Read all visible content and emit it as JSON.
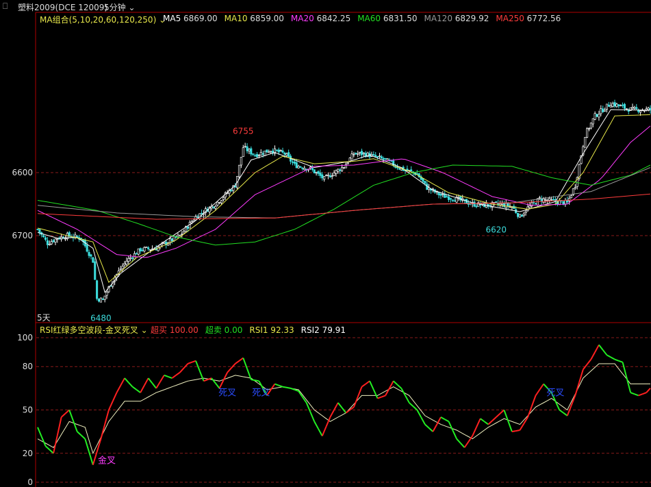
{
  "header": {
    "link_icon": "link-icon",
    "symbol": "塑料2009(DCE 12009)",
    "period": "5分钟",
    "period_caret": "chevron-down-icon"
  },
  "main_panel": {
    "ma_group_label": "MA组合(5,10,20,60,120,250)",
    "ma_legend": [
      {
        "label": "MA5",
        "value": "6869.00",
        "color": "#ffffff"
      },
      {
        "label": "MA10",
        "value": "6859.00",
        "color": "#e8e84a"
      },
      {
        "label": "MA20",
        "value": "6842.25",
        "color": "#ff3cff"
      },
      {
        "label": "MA60",
        "value": "6831.50",
        "color": "#22e022"
      },
      {
        "label": "MA120",
        "value": "6829.92",
        "color": "#9a9a9a"
      },
      {
        "label": "MA250",
        "value": "6772.56",
        "color": "#ff3c3c"
      }
    ],
    "y_ticks": [
      "6700",
      "6600"
    ],
    "period_marker": "5天",
    "annotations": [
      {
        "text": "6755",
        "color": "#ff3c3c"
      },
      {
        "text": "6620",
        "color": "#3cdcdc"
      },
      {
        "text": "6480",
        "color": "#3cdcdc"
      }
    ]
  },
  "sub_panel": {
    "indicator_label": "RSI红绿多空波段-金叉死叉",
    "legend": [
      {
        "label": "超买",
        "value": "100.00",
        "color": "#ff3c3c"
      },
      {
        "label": "超卖",
        "value": "0.00",
        "color": "#22e022"
      },
      {
        "label": "RSI1",
        "value": "92.33",
        "color": "#e8e84a"
      },
      {
        "label": "RSI2",
        "value": "79.91",
        "color": "#ffffff"
      }
    ],
    "y_ticks": [
      "100",
      "80",
      "50",
      "20",
      "0"
    ],
    "signals": [
      {
        "text": "金叉",
        "color": "#ff3cff"
      },
      {
        "text": "死叉",
        "color": "#2a4cff"
      },
      {
        "text": "死叉",
        "color": "#2a4cff"
      },
      {
        "text": "死叉",
        "color": "#2a4cff"
      }
    ]
  },
  "colors": {
    "up": "#ff3c3c",
    "down": "#3cdcdc",
    "grid": "#8a1a1a",
    "axis": "#b00000"
  },
  "chart_data": [
    {
      "type": "candlestick",
      "title": "塑料2009(DCE 12009) 5分钟",
      "ylim": [
        6480,
        6760
      ],
      "yticks": [
        6600,
        6700
      ],
      "high_label": 6755,
      "low_labels": [
        6480,
        6620
      ],
      "close_path": [
        [
          0,
          6610
        ],
        [
          5,
          6588
        ],
        [
          10,
          6596
        ],
        [
          15,
          6600
        ],
        [
          22,
          6596
        ],
        [
          28,
          6560
        ],
        [
          30,
          6500
        ],
        [
          33,
          6498
        ],
        [
          38,
          6530
        ],
        [
          45,
          6560
        ],
        [
          52,
          6578
        ],
        [
          60,
          6580
        ],
        [
          66,
          6590
        ],
        [
          72,
          6600
        ],
        [
          80,
          6630
        ],
        [
          90,
          6650
        ],
        [
          100,
          6680
        ],
        [
          104,
          6740
        ],
        [
          110,
          6728
        ],
        [
          118,
          6736
        ],
        [
          125,
          6730
        ],
        [
          130,
          6712
        ],
        [
          138,
          6706
        ],
        [
          145,
          6690
        ],
        [
          150,
          6700
        ],
        [
          155,
          6710
        ],
        [
          160,
          6730
        ],
        [
          165,
          6730
        ],
        [
          170,
          6726
        ],
        [
          176,
          6720
        ],
        [
          184,
          6706
        ],
        [
          192,
          6698
        ],
        [
          197,
          6676
        ],
        [
          204,
          6664
        ],
        [
          212,
          6658
        ],
        [
          220,
          6650
        ],
        [
          228,
          6648
        ],
        [
          234,
          6650
        ],
        [
          240,
          6646
        ],
        [
          244,
          6630
        ],
        [
          248,
          6644
        ],
        [
          254,
          6658
        ],
        [
          262,
          6654
        ],
        [
          268,
          6652
        ],
        [
          272,
          6680
        ],
        [
          277,
          6760
        ],
        [
          282,
          6790
        ],
        [
          290,
          6810
        ],
        [
          300,
          6800
        ],
        [
          310,
          6800
        ]
      ],
      "series": [
        {
          "name": "MA5",
          "path": [
            [
              0,
              6605
            ],
            [
              10,
              6596
            ],
            [
              20,
              6597
            ],
            [
              28,
              6580
            ],
            [
              34,
              6510
            ],
            [
              42,
              6540
            ],
            [
              60,
              6582
            ],
            [
              80,
              6624
            ],
            [
              100,
              6680
            ],
            [
              108,
              6720
            ],
            [
              120,
              6732
            ],
            [
              140,
              6708
            ],
            [
              158,
              6718
            ],
            [
              168,
              6728
            ],
            [
              184,
              6708
            ],
            [
              200,
              6672
            ],
            [
              220,
              6652
            ],
            [
              244,
              6638
            ],
            [
              262,
              6654
            ],
            [
              276,
              6730
            ],
            [
              290,
              6800
            ],
            [
              310,
              6799
            ]
          ]
        },
        {
          "name": "MA10",
          "path": [
            [
              0,
              6612
            ],
            [
              15,
              6600
            ],
            [
              28,
              6590
            ],
            [
              36,
              6526
            ],
            [
              50,
              6565
            ],
            [
              70,
              6593
            ],
            [
              90,
              6640
            ],
            [
              110,
              6700
            ],
            [
              124,
              6726
            ],
            [
              140,
              6714
            ],
            [
              160,
              6718
            ],
            [
              170,
              6722
            ],
            [
              190,
              6700
            ],
            [
              208,
              6668
            ],
            [
              230,
              6650
            ],
            [
              248,
              6642
            ],
            [
              262,
              6650
            ],
            [
              276,
              6700
            ],
            [
              292,
              6790
            ],
            [
              310,
              6792
            ]
          ]
        },
        {
          "name": "MA20",
          "path": [
            [
              0,
              6640
            ],
            [
              20,
              6610
            ],
            [
              40,
              6570
            ],
            [
              55,
              6565
            ],
            [
              70,
              6580
            ],
            [
              90,
              6610
            ],
            [
              110,
              6665
            ],
            [
              140,
              6710
            ],
            [
              160,
              6712
            ],
            [
              185,
              6722
            ],
            [
              205,
              6700
            ],
            [
              230,
              6662
            ],
            [
              250,
              6648
            ],
            [
              268,
              6650
            ],
            [
              285,
              6690
            ],
            [
              300,
              6748
            ],
            [
              310,
              6774
            ]
          ]
        },
        {
          "name": "MA60",
          "path": [
            [
              0,
              6656
            ],
            [
              30,
              6640
            ],
            [
              50,
              6620
            ],
            [
              70,
              6598
            ],
            [
              90,
              6585
            ],
            [
              110,
              6590
            ],
            [
              130,
              6610
            ],
            [
              150,
              6642
            ],
            [
              170,
              6680
            ],
            [
              190,
              6700
            ],
            [
              210,
              6712
            ],
            [
              240,
              6710
            ],
            [
              260,
              6692
            ],
            [
              280,
              6680
            ],
            [
              300,
              6696
            ],
            [
              310,
              6712
            ]
          ]
        },
        {
          "name": "MA120",
          "path": [
            [
              0,
              6648
            ],
            [
              40,
              6636
            ],
            [
              80,
              6630
            ],
            [
              120,
              6628
            ],
            [
              160,
              6640
            ],
            [
              200,
              6650
            ],
            [
              240,
              6652
            ],
            [
              280,
              6670
            ],
            [
              310,
              6708
            ]
          ]
        },
        {
          "name": "MA250",
          "path": [
            [
              0,
              6635
            ],
            [
              60,
              6626
            ],
            [
              120,
              6628
            ],
            [
              160,
              6640
            ],
            [
              200,
              6650
            ],
            [
              240,
              6652
            ],
            [
              280,
              6658
            ],
            [
              310,
              6666
            ]
          ]
        }
      ]
    },
    {
      "type": "line",
      "title": "RSI红绿多空波段-金叉死叉",
      "ylim": [
        0,
        100
      ],
      "yticks": [
        100,
        80,
        50,
        20,
        0
      ],
      "series": [
        {
          "name": "RSI1",
          "path": [
            [
              0,
              38
            ],
            [
              4,
              25
            ],
            [
              8,
              20
            ],
            [
              12,
              45
            ],
            [
              16,
              50
            ],
            [
              20,
              35
            ],
            [
              24,
              30
            ],
            [
              28,
              12
            ],
            [
              32,
              30
            ],
            [
              36,
              50
            ],
            [
              40,
              62
            ],
            [
              44,
              72
            ],
            [
              48,
              66
            ],
            [
              52,
              62
            ],
            [
              56,
              72
            ],
            [
              60,
              65
            ],
            [
              64,
              74
            ],
            [
              68,
              72
            ],
            [
              72,
              76
            ],
            [
              76,
              82
            ],
            [
              80,
              84
            ],
            [
              84,
              70
            ],
            [
              88,
              72
            ],
            [
              92,
              65
            ],
            [
              96,
              76
            ],
            [
              100,
              82
            ],
            [
              104,
              86
            ],
            [
              108,
              71
            ],
            [
              112,
              70
            ],
            [
              116,
              60
            ],
            [
              120,
              68
            ],
            [
              124,
              66
            ],
            [
              128,
              65
            ],
            [
              132,
              63
            ],
            [
              136,
              55
            ],
            [
              140,
              42
            ],
            [
              144,
              32
            ],
            [
              148,
              45
            ],
            [
              152,
              55
            ],
            [
              156,
              48
            ],
            [
              160,
              52
            ],
            [
              164,
              66
            ],
            [
              168,
              70
            ],
            [
              172,
              58
            ],
            [
              176,
              60
            ],
            [
              180,
              70
            ],
            [
              184,
              65
            ],
            [
              188,
              55
            ],
            [
              192,
              50
            ],
            [
              196,
              40
            ],
            [
              200,
              35
            ],
            [
              204,
              45
            ],
            [
              208,
              42
            ],
            [
              212,
              30
            ],
            [
              216,
              24
            ],
            [
              220,
              32
            ],
            [
              224,
              44
            ],
            [
              228,
              40
            ],
            [
              232,
              45
            ],
            [
              236,
              50
            ],
            [
              240,
              35
            ],
            [
              244,
              36
            ],
            [
              248,
              45
            ],
            [
              252,
              60
            ],
            [
              256,
              68
            ],
            [
              260,
              62
            ],
            [
              264,
              50
            ],
            [
              268,
              46
            ],
            [
              272,
              60
            ],
            [
              276,
              78
            ],
            [
              280,
              85
            ],
            [
              284,
              95
            ],
            [
              288,
              88
            ],
            [
              292,
              85
            ],
            [
              296,
              83
            ],
            [
              300,
              62
            ],
            [
              304,
              60
            ],
            [
              308,
              62
            ],
            [
              310,
              65
            ]
          ]
        },
        {
          "name": "RSI2",
          "path": [
            [
              0,
              30
            ],
            [
              8,
              24
            ],
            [
              16,
              42
            ],
            [
              24,
              38
            ],
            [
              28,
              20
            ],
            [
              36,
              42
            ],
            [
              44,
              56
            ],
            [
              52,
              56
            ],
            [
              60,
              62
            ],
            [
              68,
              66
            ],
            [
              76,
              70
            ],
            [
              84,
              72
            ],
            [
              92,
              70
            ],
            [
              100,
              74
            ],
            [
              108,
              72
            ],
            [
              116,
              64
            ],
            [
              124,
              66
            ],
            [
              132,
              64
            ],
            [
              140,
              50
            ],
            [
              148,
              42
            ],
            [
              156,
              48
            ],
            [
              164,
              60
            ],
            [
              172,
              60
            ],
            [
              180,
              66
            ],
            [
              188,
              60
            ],
            [
              196,
              46
            ],
            [
              204,
              40
            ],
            [
              212,
              36
            ],
            [
              220,
              30
            ],
            [
              228,
              38
            ],
            [
              236,
              44
            ],
            [
              244,
              40
            ],
            [
              252,
              52
            ],
            [
              260,
              58
            ],
            [
              268,
              50
            ],
            [
              276,
              72
            ],
            [
              284,
              82
            ],
            [
              292,
              82
            ],
            [
              300,
              68
            ],
            [
              310,
              68
            ]
          ]
        }
      ]
    }
  ]
}
